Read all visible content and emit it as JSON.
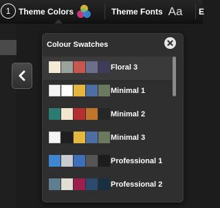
{
  "toolbar": {
    "step_number": "1",
    "theme_colors_label": "Theme Colors",
    "theme_fonts_label": "Theme Fonts",
    "theme_fonts_icon_text": "Aa",
    "truncated_label": "E"
  },
  "panel": {
    "title": "Colour Swatches",
    "items": [
      {
        "label": "Floral 3",
        "selected": true,
        "colors": [
          "#f3ead6",
          "#9aa39b",
          "#c6574f",
          "#6a6f8b",
          "#3e3b5b"
        ]
      },
      {
        "label": "Minimal 1",
        "selected": false,
        "colors": [
          "#f5f5f5",
          "#ffffff",
          "#e6b73e",
          "#4d6fa3",
          "#6b7a5f"
        ]
      },
      {
        "label": "Minimal 2",
        "selected": false,
        "colors": [
          "#2a7c72",
          "#f2e6cf",
          "#b43130",
          "#c1752a",
          "#262626"
        ]
      },
      {
        "label": "Minimal 3",
        "selected": false,
        "colors": [
          "#f5f5f5",
          "#1e1e1e",
          "#e6b73e",
          "#4d6fa3",
          "#6b7a5f"
        ]
      },
      {
        "label": "Professional 1",
        "selected": false,
        "colors": [
          "#3f86d1",
          "#c9ccce",
          "#3f6fb8",
          "#555555",
          "#1d1d1d"
        ]
      },
      {
        "label": "Professional 2",
        "selected": false,
        "colors": [
          "#5f7f91",
          "#e1ded4",
          "#9c1f4c",
          "#2c4a6b",
          "#18303f"
        ]
      }
    ]
  }
}
